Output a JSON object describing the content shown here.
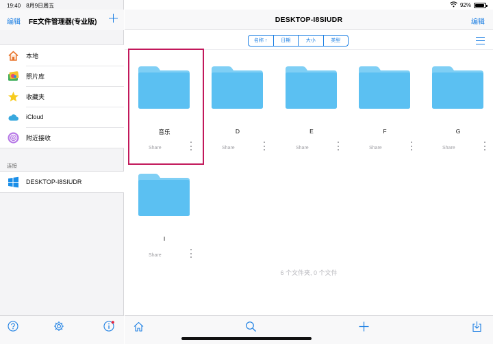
{
  "status_bar": {
    "time": "19:40",
    "date": "8月9日周五",
    "battery": "92%",
    "battery_level": 0.92
  },
  "sidebar": {
    "edit_label": "编辑",
    "title": "FE文件管理器(专业版)",
    "places": [
      {
        "label": "本地",
        "icon": "house-icon"
      },
      {
        "label": "照片库",
        "icon": "photos-icon"
      },
      {
        "label": "收藏夹",
        "icon": "star-icon"
      },
      {
        "label": "iCloud",
        "icon": "cloud-icon"
      },
      {
        "label": "附近接收",
        "icon": "airdrop-icon"
      }
    ],
    "connections_header": "连接",
    "connections": [
      {
        "label": "DESKTOP-I8SIUDR",
        "icon": "windows-icon"
      }
    ]
  },
  "main": {
    "title": "DESKTOP-I8SIUDR",
    "edit_label": "编辑",
    "sort_options": [
      "名称 ↑",
      "日期",
      "大小",
      "类型"
    ],
    "folders": [
      {
        "name": "音乐",
        "share": "Share"
      },
      {
        "name": "D",
        "share": "Share"
      },
      {
        "name": "E",
        "share": "Share"
      },
      {
        "name": "F",
        "share": "Share"
      },
      {
        "name": "G",
        "share": "Share"
      },
      {
        "name": "I",
        "share": "Share"
      }
    ],
    "summary": "6 个文件夹, 0 个文件"
  },
  "colors": {
    "accent": "#1a7ee3",
    "folder": "#5bc0f2",
    "folder_tab": "#7fcff5",
    "selection": "#c2185b"
  }
}
